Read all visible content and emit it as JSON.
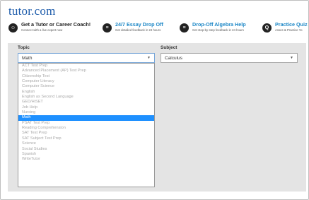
{
  "header": {
    "logo": "tutor.com",
    "promos": [
      {
        "icon": "person-chat-icon",
        "title": "Get a Tutor or Career Coach!",
        "subtitle": "Connect with a live expert now"
      },
      {
        "icon": "essay-icon",
        "title": "24/7 Essay Drop Off",
        "subtitle": "Get detailed feedback in 24 hours"
      },
      {
        "icon": "algebra-icon",
        "title": "Drop-Off Algebra Help",
        "subtitle": "Get step-by-step feedback in 24 hours"
      },
      {
        "icon": "quiz-icon",
        "title": "Practice Quiz",
        "subtitle": "Asses & Practice Yo"
      }
    ]
  },
  "form": {
    "topic_label": "Topic",
    "topic_value": "Math",
    "subject_label": "Subject",
    "subject_value": "Calculus",
    "topic_options": [
      "ACT Test Prep",
      "Advanced Placement (AP) Test Prep",
      "Citizenship Test",
      "Computer Literacy",
      "Computer Science",
      "English",
      "English as Second Language",
      "GED/HiSET",
      "Job Help",
      "Nursing",
      "Math",
      "PSAT Test Prep",
      "Reading Comprehension",
      "SAT Test Prep",
      "SAT Subject Test Prep",
      "Science",
      "Social Studies",
      "Spanish",
      "WriteTutor"
    ],
    "selected_option": "Math"
  }
}
